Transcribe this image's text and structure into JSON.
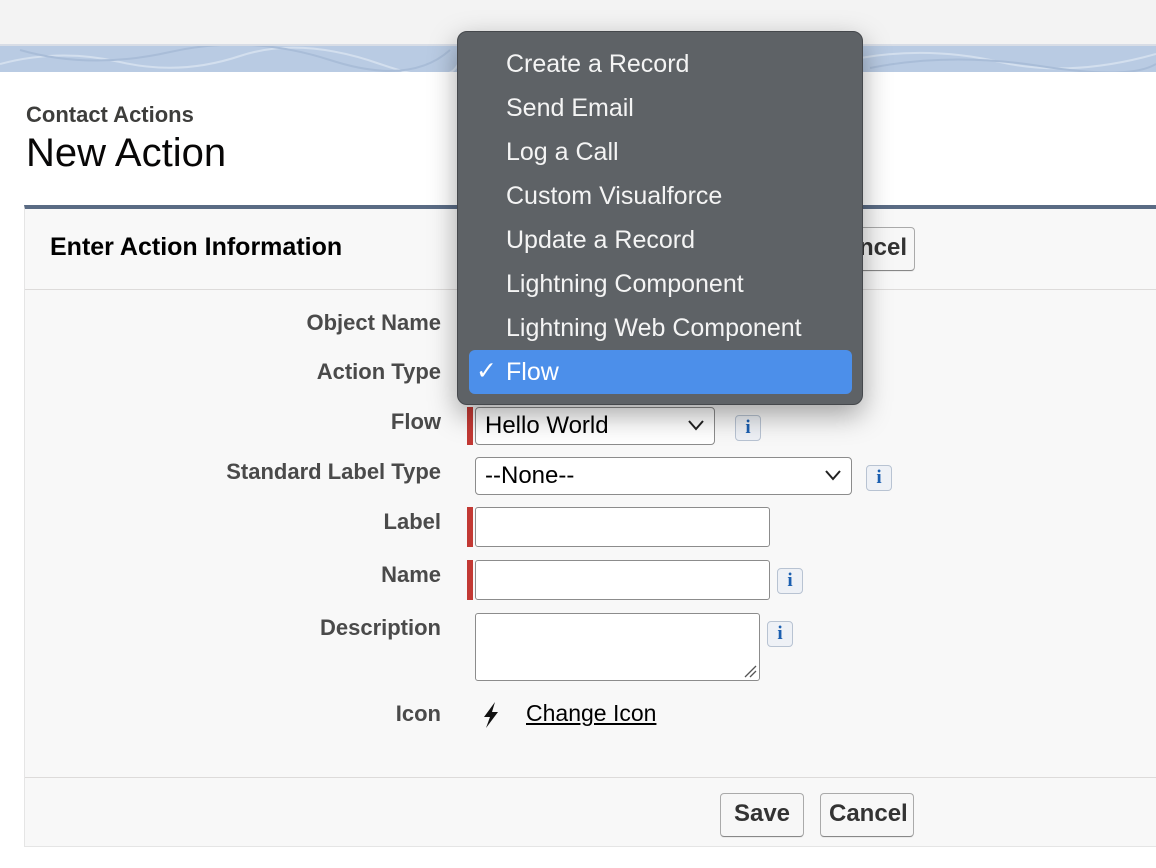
{
  "header": {
    "subtitle": "Contact Actions",
    "title": "New Action"
  },
  "panel": {
    "title": "Enter Action Information",
    "cancel_top_partial": "ncel"
  },
  "form": {
    "object_name_label": "Object Name",
    "action_type_label": "Action Type",
    "flow_label": "Flow",
    "flow_value": "Hello World",
    "standard_label_type_label": "Standard Label Type",
    "standard_label_type_value": "--None--",
    "label_label": "Label",
    "name_label": "Name",
    "description_label": "Description",
    "icon_label": "Icon",
    "change_icon_link": "Change Icon"
  },
  "info_glyph": "i",
  "footer": {
    "save_label": "Save",
    "cancel_label": "Cancel"
  },
  "dropdown": {
    "items": [
      "Create a Record",
      "Send Email",
      "Log a Call",
      "Custom Visualforce",
      "Update a Record",
      "Lightning Component",
      "Lightning Web Component",
      "Flow"
    ],
    "selected_index": 7,
    "checkmark": "✓"
  },
  "colors": {
    "required_marker": "#c23934",
    "menu_background": "#5e6266",
    "menu_selected": "#4c8fea",
    "panel_top_border": "#5a6b84"
  },
  "icons": {
    "icon_preview": "lightning-bolt-icon",
    "info": "info-icon",
    "select_arrow": "chevron-down-icon"
  }
}
